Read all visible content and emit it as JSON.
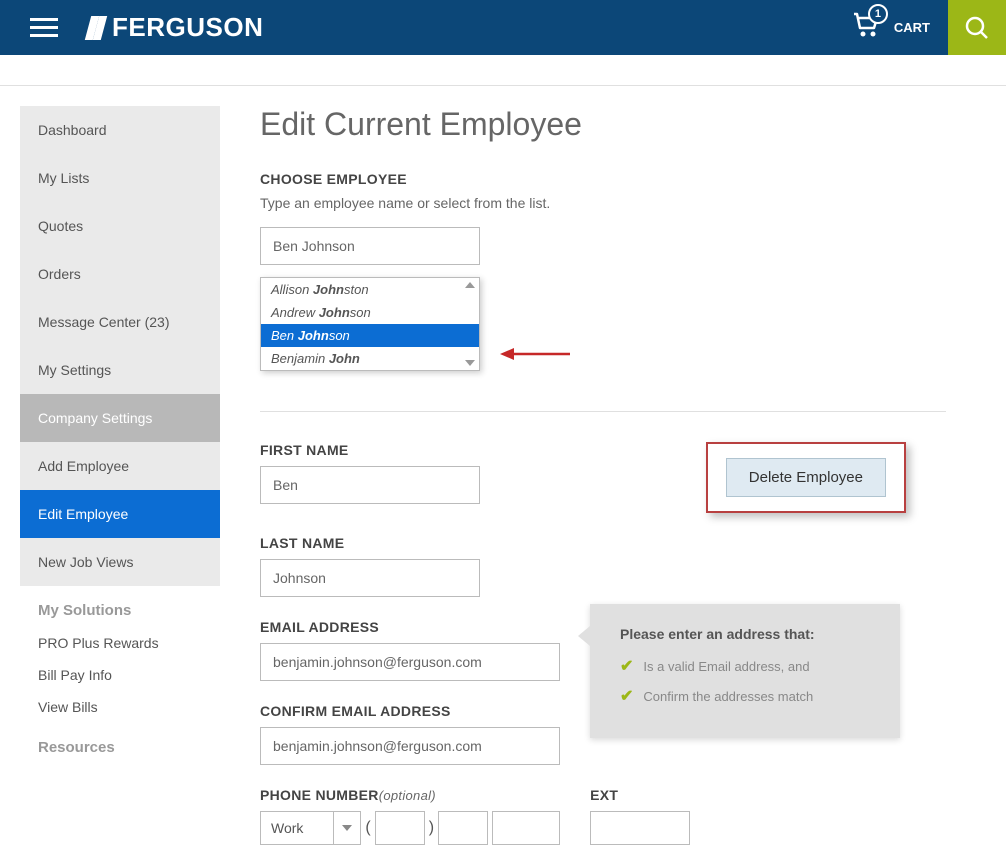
{
  "header": {
    "brand": "FERGUSON",
    "cart_count": "1",
    "cart_label": "CART"
  },
  "sidebar": {
    "items": [
      {
        "label": "Dashboard"
      },
      {
        "label": "My Lists"
      },
      {
        "label": "Quotes"
      },
      {
        "label": "Orders"
      },
      {
        "label": "Message Center (23)"
      },
      {
        "label": "My Settings"
      },
      {
        "label": "Company Settings"
      },
      {
        "label": "Add Employee"
      },
      {
        "label": "Edit Employee"
      },
      {
        "label": "New Job Views"
      }
    ],
    "solutions_heading": "My Solutions",
    "solutions": [
      {
        "label": "PRO Plus Rewards"
      },
      {
        "label": "Bill Pay Info"
      },
      {
        "label": "View Bills"
      }
    ],
    "resources_heading": "Resources"
  },
  "main": {
    "title": "Edit Current Employee",
    "choose_label": "CHOOSE EMPLOYEE",
    "choose_hint": "Type an employee name or select from the list.",
    "choose_value": "Ben Johnson",
    "autocomplete": [
      {
        "pre": "Allison ",
        "bold": "John",
        "post": "ston"
      },
      {
        "pre": "Andrew ",
        "bold": "John",
        "post": "son"
      },
      {
        "pre": "Ben ",
        "bold": "John",
        "post": "son"
      },
      {
        "pre": "Benjamin ",
        "bold": "John",
        "post": ""
      }
    ],
    "first_name_label": "FIRST NAME",
    "first_name_value": "Ben",
    "delete_label": "Delete Employee",
    "last_name_label": "LAST NAME",
    "last_name_value": "Johnson",
    "email_label": "EMAIL ADDRESS",
    "email_value": "benjamin.johnson@ferguson.com",
    "confirm_email_label": "CONFIRM EMAIL ADDRESS",
    "confirm_email_value": "benjamin.johnson@ferguson.com",
    "tooltip_title": "Please enter an address that:",
    "tooltip_items": [
      "Is a valid Email address, and",
      "Confirm the addresses match"
    ],
    "phone_label": "PHONE NUMBER",
    "phone_optional": "(optional)",
    "phone_type": "Work",
    "ext_label": "EXT"
  }
}
